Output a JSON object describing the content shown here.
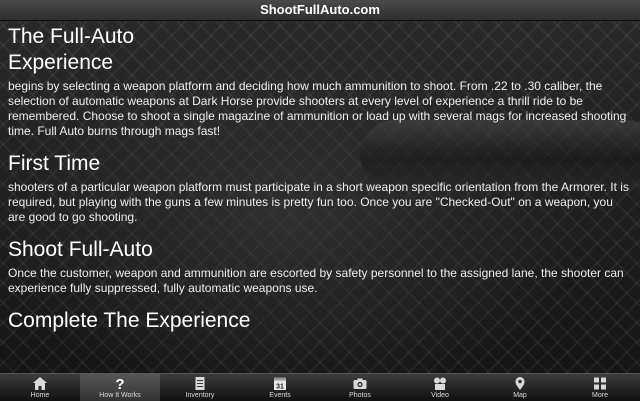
{
  "header": {
    "title": "ShootFullAuto.com"
  },
  "sections": [
    {
      "heading_line1": "The Full-Auto",
      "heading_line2": "Experience",
      "body": "begins by selecting a weapon platform and deciding how much ammunition to shoot.  From .22 to .30 caliber, the selection of automatic weapons at Dark Horse provide shooters at every level of experience a thrill ride to be remembered.  Choose to shoot a single magazine of ammunition or load up with several mags for increased shooting time.  Full Auto burns through mags fast!"
    },
    {
      "heading": "First Time",
      "body": "shooters of a particular weapon platform must participate in a short weapon specific orientation from the Armorer.  It is required, but playing with the guns a few minutes is pretty fun too.  Once you are \"Checked-Out\" on a weapon, you are good to go shooting."
    },
    {
      "heading": "Shoot Full-Auto",
      "body": "Once the customer, weapon and ammunition are escorted by safety personnel to the assigned lane, the shooter can experience fully suppressed, fully automatic weapons use."
    },
    {
      "heading": "Complete The Experience"
    }
  ],
  "tabs": [
    {
      "label": "Home",
      "icon": "home-icon",
      "active": false
    },
    {
      "label": "How It Works",
      "icon": "question-icon",
      "active": true
    },
    {
      "label": "Inventory",
      "icon": "document-icon",
      "active": false
    },
    {
      "label": "Events",
      "icon": "calendar-icon",
      "calendar_day": "31",
      "active": false
    },
    {
      "label": "Photos",
      "icon": "camera-icon",
      "active": false
    },
    {
      "label": "Video",
      "icon": "film-icon",
      "active": false
    },
    {
      "label": "Map",
      "icon": "map-pin-icon",
      "active": false
    },
    {
      "label": "More",
      "icon": "more-grid-icon",
      "active": false
    }
  ]
}
